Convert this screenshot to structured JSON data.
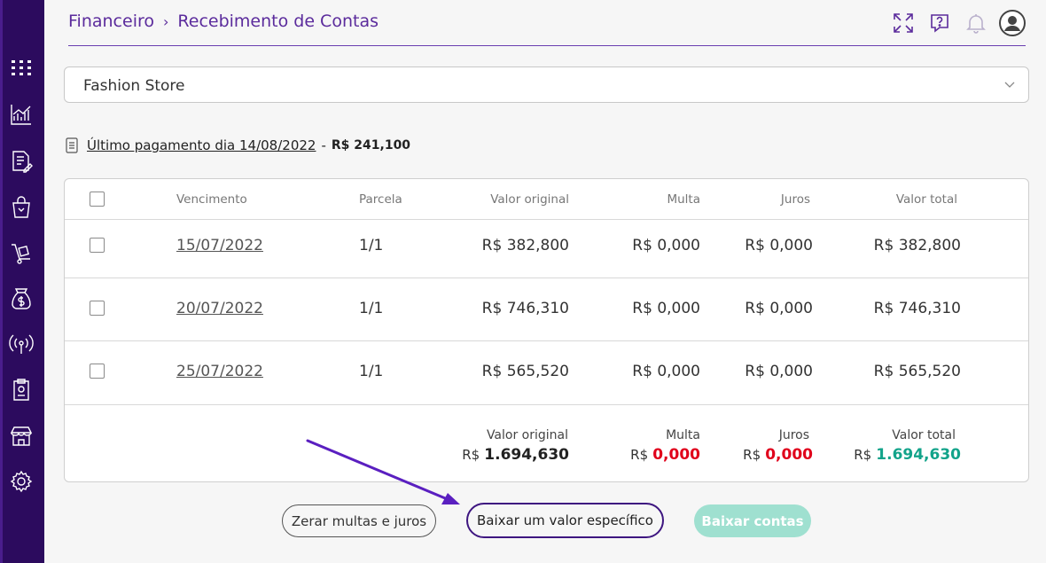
{
  "breadcrumb": {
    "section": "Financeiro",
    "separator": "›",
    "page": "Recebimento de Contas"
  },
  "header_icons": [
    "expand-icon",
    "help-chat-icon",
    "bell-icon",
    "user-avatar-icon"
  ],
  "sidebar": {
    "items": [
      "apps-grid-icon",
      "chart-icon",
      "document-edit-icon",
      "shopping-bag-icon",
      "hand-truck-icon",
      "money-bag-icon",
      "broadcast-icon",
      "report-icon",
      "storefront-icon",
      "settings-gear-icon"
    ]
  },
  "store_select": {
    "value": "Fashion Store"
  },
  "last_payment": {
    "text": "Último pagamento dia 14/08/2022",
    "separator": "-",
    "amount": "R$ 241,100"
  },
  "table": {
    "columns": [
      "Vencimento",
      "Parcela",
      "Valor original",
      "Multa",
      "Juros",
      "Valor total"
    ],
    "rows": [
      {
        "vencimento": "15/07/2022",
        "parcela": "1/1",
        "valor_original": "R$ 382,800",
        "multa": "R$ 0,000",
        "juros": "R$ 0,000",
        "valor_total": "R$ 382,800"
      },
      {
        "vencimento": "20/07/2022",
        "parcela": "1/1",
        "valor_original": "R$ 746,310",
        "multa": "R$ 0,000",
        "juros": "R$ 0,000",
        "valor_total": "R$ 746,310"
      },
      {
        "vencimento": "25/07/2022",
        "parcela": "1/1",
        "valor_original": "R$ 565,520",
        "multa": "R$ 0,000",
        "juros": "R$ 0,000",
        "valor_total": "R$ 565,520"
      }
    ],
    "totals": {
      "valor_original_label": "Valor original",
      "valor_original_currency": "R$",
      "valor_original": "1.694,630",
      "multa_label": "Multa",
      "multa_currency": "R$",
      "multa": "0,000",
      "juros_label": "Juros",
      "juros_currency": "R$",
      "juros": "0,000",
      "valor_total_label": "Valor total",
      "valor_total_currency": "R$",
      "valor_total": "1.694,630"
    }
  },
  "buttons": {
    "reset": "Zerar multas e juros",
    "specific": "Baixar um valor específico",
    "settle": "Baixar contas"
  },
  "colors": {
    "sidebar": "#2c0b5e",
    "accent": "#5b2b9c",
    "green": "#12a38a",
    "red": "#e0001b",
    "disabled_button": "#9fe0d0"
  }
}
